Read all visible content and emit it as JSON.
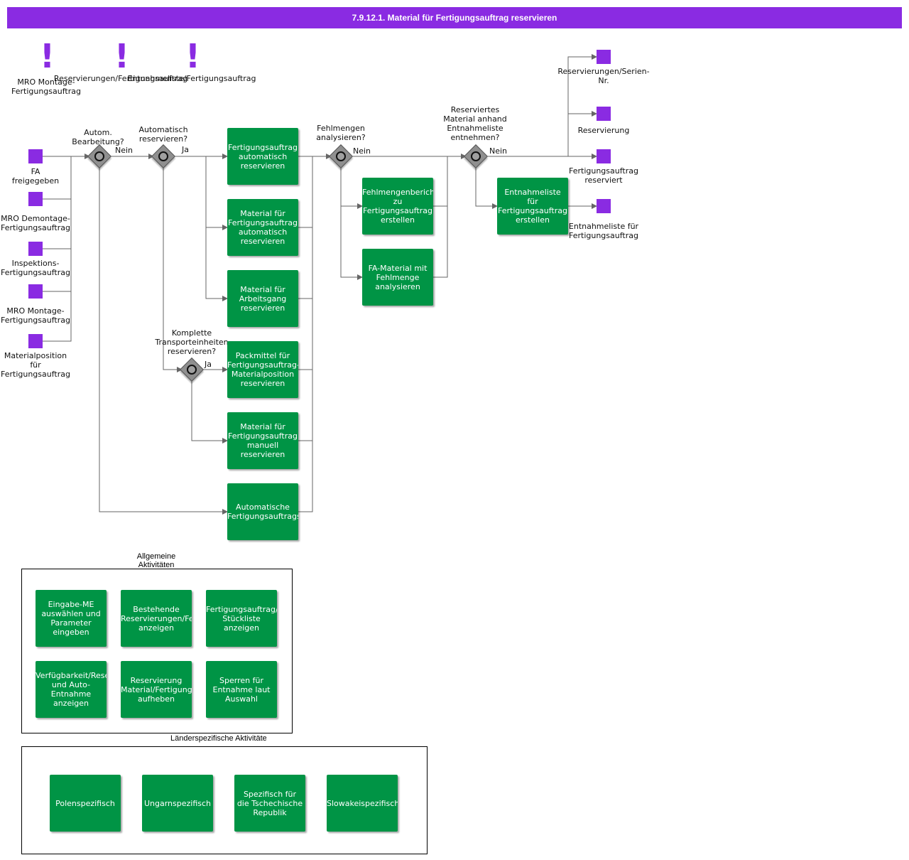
{
  "header": {
    "title": "7.9.12.1. Material für Fertigungsauftrag reservieren"
  },
  "triggers": [
    "MRO Montage-\nFertigungsauftrag",
    "Reservierungen/Fertigungsauftrag",
    "Entnahmeliste/Fertigungsauftrag"
  ],
  "start_events": [
    "FA\nfreigegeben",
    "MRO Demontage-\nFertigungsauftrag",
    "Inspektions-\nFertigungsauftrag",
    "MRO Montage-\nFertigungsauftrag",
    "Materialposition\nfür\nFertigungsauftrag"
  ],
  "gateways": {
    "g1": "Autom.\nBearbeitung?",
    "g2": "Automatisch\nreservieren?",
    "g3": "Komplette\nTransporteinheiten\nreservieren?",
    "g4": "Fehlmengen\nanalysieren?",
    "g5": "Reserviertes\nMaterial anhand\nEntnahmeliste\nentnehmen?"
  },
  "edge_labels": {
    "nein1": "Nein",
    "ja2": "Ja",
    "ja3": "Ja",
    "nein4": "Nein",
    "nein5": "Nein"
  },
  "tasks": {
    "t1": "Fertigungsauftrag\nautomatisch\nreservieren",
    "t2": "Material für\nFertigungsauftrag\nautomatisch\nreservieren",
    "t3": "Material für\nArbeitsgang\nreservieren",
    "t4": "Packmittel für\nFertigungsauftrag-\nMaterialposition\nreservieren",
    "t5": "Material für\nFertigungsauftrag\nmanuell\nreservieren",
    "t6": "Automatische\nFertigungsauftragsbearbeitung",
    "t7": "Fehlmengenbericht\nzu\nFertigungsauftrag\nerstellen",
    "t8": "FA-Material mit\nFehlmenge\nanalysieren",
    "t9": "Entnahmeliste\nfür\nFertigungsauftrag\nerstellen"
  },
  "end_events": [
    "Reservierungen/Serien-\nNr.",
    "Reservierung",
    "Fertigungsauftrag\nreserviert",
    "Entnahmeliste für\nFertigungsauftrag"
  ],
  "general": {
    "title": "Allgemeine\nAktivitäten",
    "items": [
      "Eingabe-ME\nauswählen und\nParameter\neingeben",
      "Bestehende\nReservierungen/Fertigungsauftrag\nanzeigen",
      "Fertigungsauftrag/Verfolgte\nStückliste anzeigen",
      "Verfügbarkeit/Reservierung\nund Auto-Entnahme\nanzeigen",
      "Reservierung\nMaterial/Fertigungsauftrag\naufheben",
      "Sperren für\nEntnahme laut\nAuswahl"
    ]
  },
  "country": {
    "title": "Länderspezifische Aktivitäten",
    "items": [
      "Polenspezifisch",
      "Ungarnspezifisch",
      "Spezifisch für\ndie Tschechische\nRepublik",
      "Slowakeispezifisch"
    ]
  },
  "colors": {
    "accent": "#8a2be2",
    "task": "#009445",
    "gateway": "#8f8f8f",
    "line": "#666666"
  }
}
